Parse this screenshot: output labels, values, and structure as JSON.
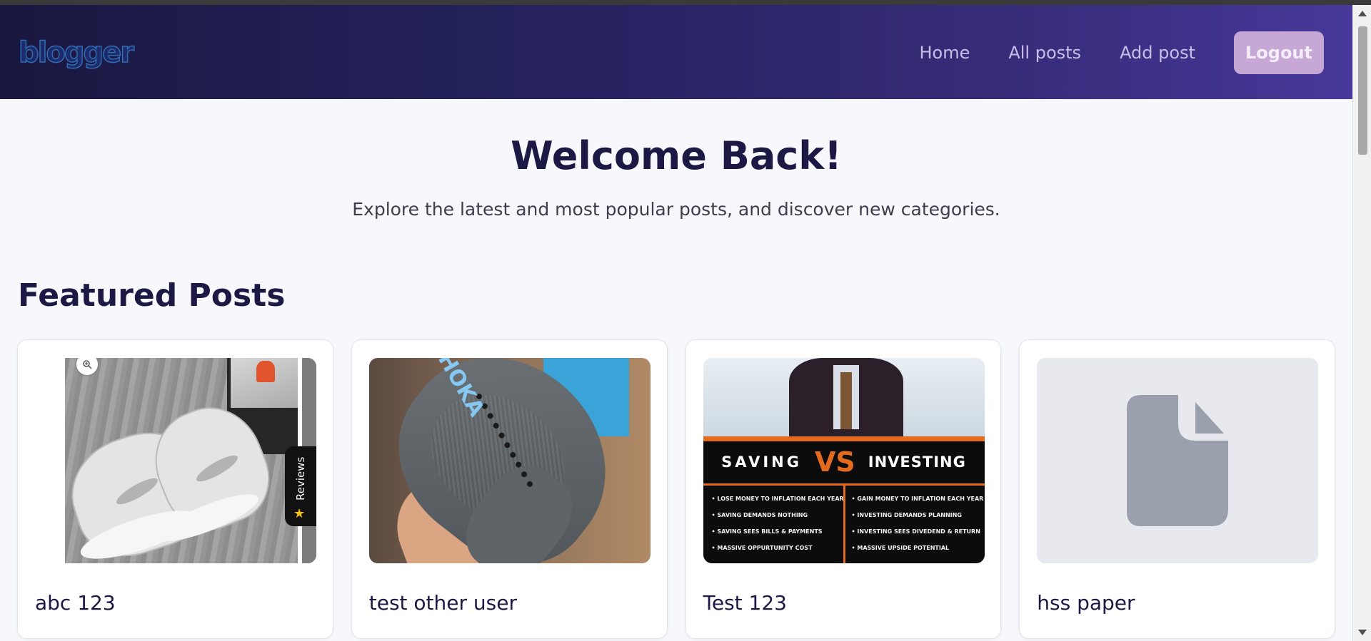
{
  "app": {
    "logo_text": "blogger"
  },
  "nav": {
    "links": [
      "Home",
      "All posts",
      "Add post"
    ],
    "logout_label": "Logout"
  },
  "hero": {
    "title": "Welcome Back!",
    "subtitle": "Explore the latest and most popular posts, and discover new categories."
  },
  "featured": {
    "heading": "Featured Posts",
    "posts": [
      {
        "title": "abc 123",
        "image": "sneakers-photo",
        "reviews_label": "Reviews"
      },
      {
        "title": "test other user",
        "image": "running-shoe-photo",
        "brand_text": "HOKA"
      },
      {
        "title": "Test 123",
        "image": "saving-vs-investing-graphic",
        "graphic": {
          "left_heading": "SAVING",
          "vs": "VS",
          "right_heading": "INVESTING",
          "left_points": [
            "LOSE MONEY TO INFLATION EACH YEAR",
            "SAVING DEMANDS NOTHING",
            "SAVING SEES BILLS & PAYMENTS",
            "MASSIVE OPPURTUNITY COST"
          ],
          "right_points": [
            "GAIN MONEY TO INFLATION EACH YEAR",
            "INVESTING DEMANDS PLANNING",
            "INVESTING SEES DIVEDEND & RETURN",
            "MASSIVE UPSIDE POTENTIAL"
          ]
        }
      },
      {
        "title": "hss paper",
        "image": "document-placeholder-icon"
      }
    ]
  },
  "colors": {
    "nav_gradient_start": "#1a1840",
    "nav_gradient_end": "#47389a",
    "logout_bg": "#c6a7d6",
    "heading": "#1c1a45",
    "page_bg": "#f7f8fb",
    "accent_orange": "#e46b1d"
  }
}
